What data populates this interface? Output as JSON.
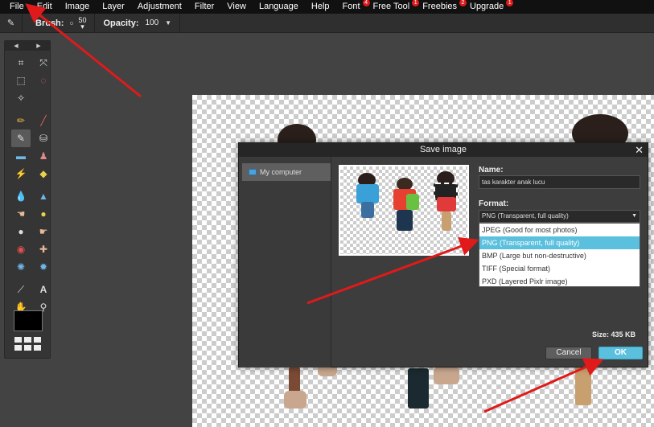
{
  "menubar": {
    "items": [
      {
        "label": "File",
        "badge": ""
      },
      {
        "label": "Edit",
        "badge": ""
      },
      {
        "label": "Image",
        "badge": ""
      },
      {
        "label": "Layer",
        "badge": ""
      },
      {
        "label": "Adjustment",
        "badge": ""
      },
      {
        "label": "Filter",
        "badge": ""
      },
      {
        "label": "View",
        "badge": ""
      },
      {
        "label": "Language",
        "badge": ""
      },
      {
        "label": "Help",
        "badge": ""
      },
      {
        "label": "Font",
        "badge": "4"
      },
      {
        "label": "Free Tool",
        "badge": "1"
      },
      {
        "label": "Freebies",
        "badge": "2"
      },
      {
        "label": "Upgrade",
        "badge": "1"
      }
    ]
  },
  "options": {
    "brush_label": "Brush:",
    "brush_size": "50",
    "opacity_label": "Opacity:",
    "opacity_value": "100"
  },
  "toolbar": {
    "tools": [
      "crop-icon",
      "move-icon",
      "marquee-icon",
      "lasso-icon",
      "wand-icon",
      "pencil-icon",
      "brush-icon",
      "eraser-icon",
      "bucket-icon",
      "gradient-icon",
      "stamp-icon",
      "colorreplace-icon",
      "drawing-icon",
      "blur-icon",
      "sharpen-icon",
      "smudge-icon",
      "sponge-icon",
      "dodge-icon",
      "burn-icon",
      "redeye-icon",
      "spotheal-icon",
      "bloat-icon",
      "pinch-icon",
      "picker-icon",
      "type-icon",
      "hand-icon",
      "zoom-icon"
    ],
    "primary_color": "#000000"
  },
  "dialog": {
    "title": "Save image",
    "close_glyph": "✕",
    "location": "My computer",
    "name_label": "Name:",
    "name_value": "tas karakter anak lucu",
    "format_label": "Format:",
    "format_selected": "PNG (Transparent, full quality)",
    "format_options": [
      "JPEG (Good for most photos)",
      "PNG (Transparent, full quality)",
      "BMP (Large but non-destructive)",
      "TIFF (Special format)",
      "PXD (Layered Pixlr image)"
    ],
    "selected_index": 1,
    "size_text": "Size: 435 KB",
    "cancel_label": "Cancel",
    "ok_label": "OK"
  },
  "colors": {
    "accent": "#5bc0de",
    "annotation": "#e01a1a"
  }
}
